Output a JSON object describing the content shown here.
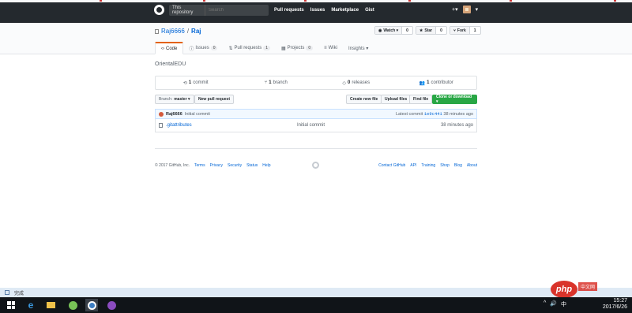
{
  "header": {
    "search_scope": "This repository",
    "search_placeholder": "Search",
    "nav": [
      "Pull requests",
      "Issues",
      "Marketplace",
      "Gist"
    ],
    "plus": "+▾"
  },
  "repo": {
    "owner": "Raj6666",
    "separator": "/",
    "name": "Raj",
    "watch_label": "Watch ▾",
    "watch_count": "0",
    "star_label": "Star",
    "star_count": "0",
    "fork_label": "Fork",
    "fork_count": "1",
    "description": "OrientalEDU"
  },
  "tabs": [
    {
      "label": "Code",
      "icon": "‹›",
      "count": ""
    },
    {
      "label": "Issues",
      "icon": "ⓘ",
      "count": "0"
    },
    {
      "label": "Pull requests",
      "icon": "⇅",
      "count": "1"
    },
    {
      "label": "Projects",
      "icon": "▦",
      "count": "0"
    },
    {
      "label": "Wiki",
      "icon": "≡",
      "count": ""
    },
    {
      "label": "Insights ▾",
      "icon": "",
      "count": ""
    }
  ],
  "numbers": {
    "commits_n": "1",
    "commits_label": "commit",
    "branch_n": "1",
    "branch_label": "branch",
    "releases_n": "0",
    "releases_label": "releases",
    "contrib_n": "1",
    "contrib_label": "contributor"
  },
  "filebar": {
    "branch_prefix": "Branch:",
    "branch": "master ▾",
    "new_pr": "New pull request",
    "create_file": "Create new file",
    "upload": "Upload files",
    "find": "Find file",
    "clone": "Clone or download ▾"
  },
  "commit": {
    "author": "Raj6666",
    "message": "Initial commit",
    "latest_prefix": "Latest commit",
    "sha": "1e9c441",
    "age": "38 minutes ago"
  },
  "files": [
    {
      "name": ".gitattributes",
      "message": "Initial commit",
      "age": "38 minutes ago"
    }
  ],
  "footer": {
    "copyright": "© 2017 GitHub, Inc.",
    "left_links": [
      "Terms",
      "Privacy",
      "Security",
      "Status",
      "Help"
    ],
    "right_links": [
      "Contact GitHub",
      "API",
      "Training",
      "Shop",
      "Blog",
      "About"
    ]
  },
  "statusbar": {
    "text": "完成"
  },
  "watermark": {
    "badge": "php",
    "site": "中文网"
  },
  "clock": {
    "time": "15:27",
    "date": "2017/6/26"
  },
  "tray": {
    "chevron": "^",
    "speaker": "🔊",
    "ime": "中"
  }
}
